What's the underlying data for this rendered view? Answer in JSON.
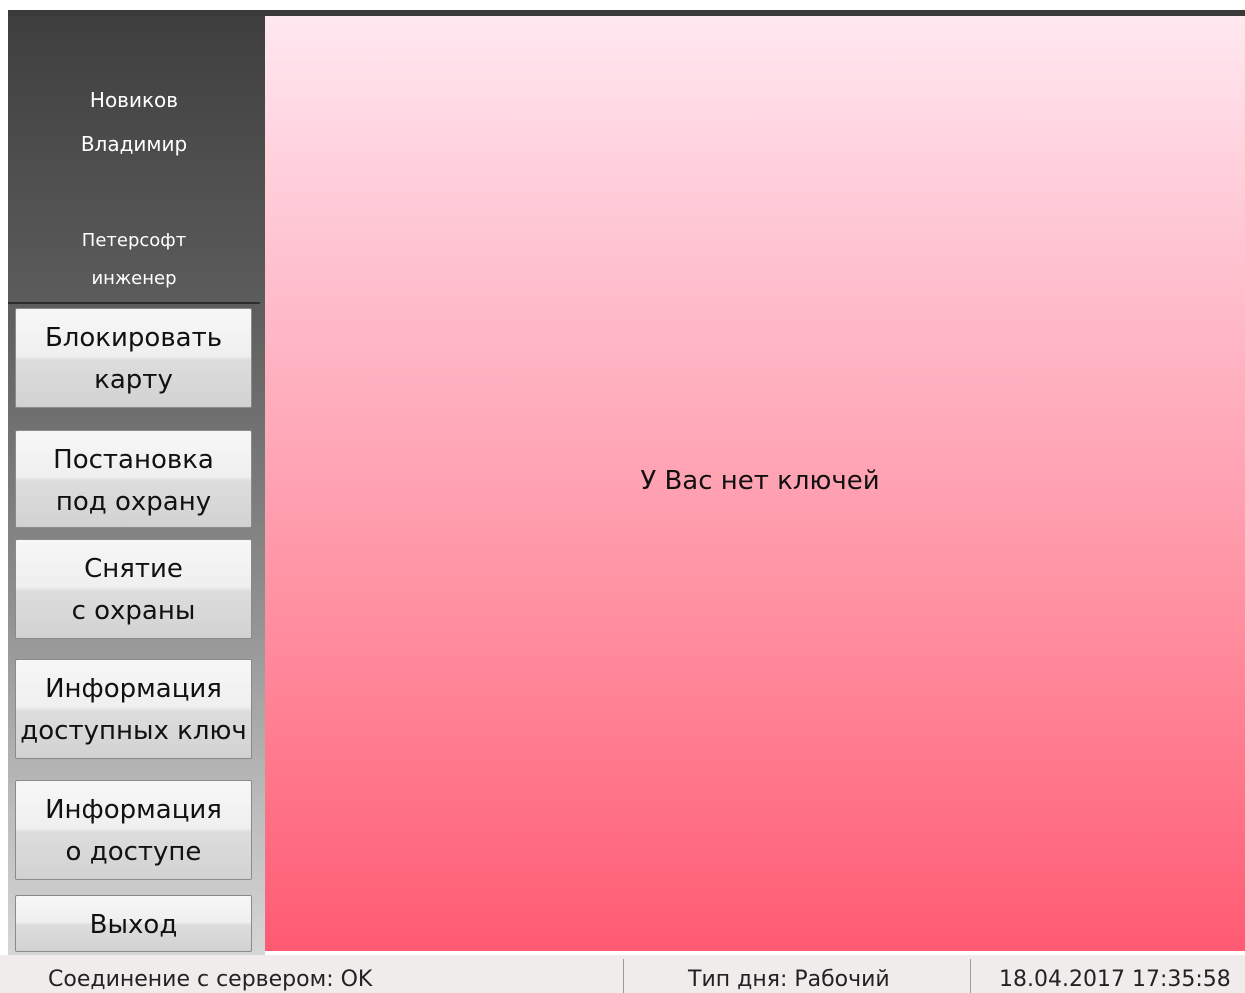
{
  "user": {
    "last_name": "Новиков",
    "first_name": "Владимир",
    "company": "Петерсофт",
    "position": "инженер"
  },
  "sidebar": {
    "buttons": [
      {
        "line1": "Блокировать",
        "line2": "карту"
      },
      {
        "line1": "Постановка",
        "line2": "под охрану"
      },
      {
        "line1": "Снятие",
        "line2": "с охраны"
      },
      {
        "line1": "Информация",
        "line2": "доступных ключ"
      },
      {
        "line1": "Информация",
        "line2": "о доступе"
      },
      {
        "line1": "Выход"
      }
    ]
  },
  "main": {
    "message": "У Вас нет ключей"
  },
  "status": {
    "connection": "Соединение с сервером: OK",
    "day_type": "Тип дня: Рабочий",
    "datetime": "18.04.2017 17:35:58"
  },
  "colors": {
    "sidebar_top": "#3e3e3e",
    "panel_top": "#ffe8f0",
    "panel_bottom": "#ff5b73",
    "status_bg": "#f0ecec"
  }
}
